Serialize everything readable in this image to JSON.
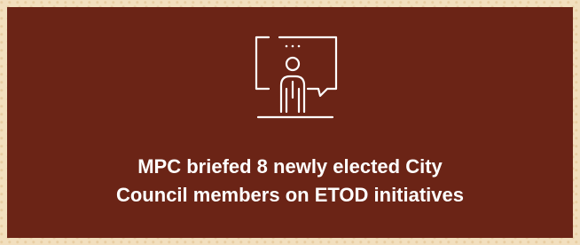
{
  "card": {
    "icon": "presenter-board-icon",
    "caption_line1": "MPC briefed 8 newly elected City",
    "caption_line2": "Council members on ETOD initiatives",
    "background_color": "#6b2416",
    "text_color": "#ffffff"
  }
}
